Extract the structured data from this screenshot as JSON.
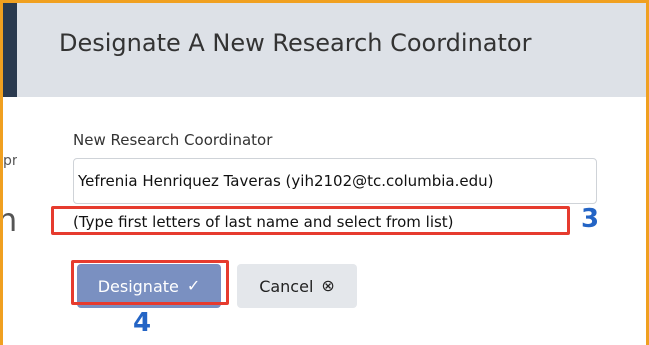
{
  "background": {
    "partial_text_a": "pr",
    "partial_text_b": "na"
  },
  "modal": {
    "title": "Designate A New Research Coordinator",
    "field_label": "New Research Coordinator",
    "field_value": "Yefrenia Henriquez Taveras (yih2102@tc.columbia.edu)",
    "hint": "(Type first letters of last name and select from list)",
    "designate_label": "Designate",
    "designate_icon": "✓",
    "cancel_label": "Cancel",
    "cancel_icon": "⊗"
  },
  "annotations": {
    "step_3": "3",
    "step_4": "4"
  },
  "colors": {
    "frame": "#f0a020",
    "annotation_box": "#e63b2e",
    "annotation_number": "#2364c5",
    "primary_button": "#7a90c1",
    "header_bg": "#dde1e7"
  }
}
